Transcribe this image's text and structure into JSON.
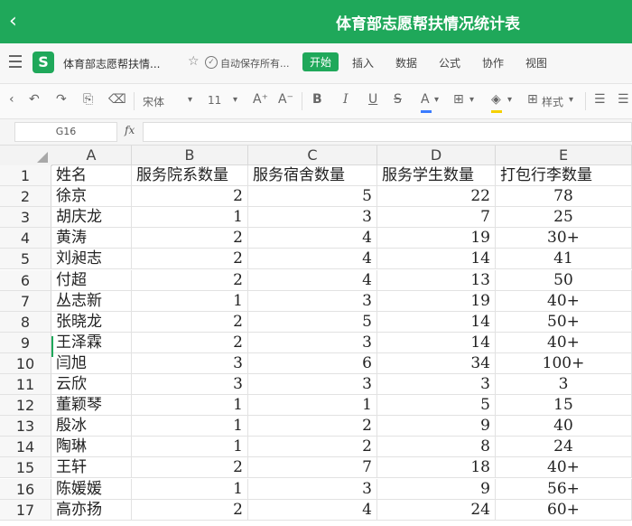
{
  "header": {
    "back_icon": "chevron-left-icon",
    "title": "体育部志愿帮扶情况统计表"
  },
  "menubar": {
    "file_name": "体育部志愿帮扶情...",
    "autosave": "自动保存所有...",
    "tabs": [
      "开始",
      "插入",
      "数据",
      "公式",
      "协作",
      "视图"
    ],
    "active_tab": "开始",
    "accent": "#1fa85a"
  },
  "toolbar": {
    "font_name": "宋体",
    "font_size": "11",
    "style_label": "样式"
  },
  "formula": {
    "name_box": "G16",
    "fx": "fx",
    "value": ""
  },
  "sheet": {
    "columns": [
      "A",
      "B",
      "C",
      "D",
      "E"
    ],
    "rows": [
      "1",
      "2",
      "3",
      "4",
      "5",
      "6",
      "7",
      "8",
      "9",
      "10",
      "11",
      "12",
      "13",
      "14",
      "15",
      "16",
      "17"
    ],
    "header_row": [
      "姓名",
      "服务院系数量",
      "服务宿舍数量",
      "服务学生数量",
      "打包行李数量"
    ],
    "data": [
      [
        "徐京",
        "2",
        "5",
        "22",
        "78"
      ],
      [
        "胡庆龙",
        "1",
        "3",
        "7",
        "25"
      ],
      [
        "黄涛",
        "2",
        "4",
        "19",
        "30+"
      ],
      [
        "刘昶志",
        "2",
        "4",
        "14",
        "41"
      ],
      [
        "付超",
        "2",
        "4",
        "13",
        "50"
      ],
      [
        "丛志新",
        "1",
        "3",
        "19",
        "40+"
      ],
      [
        "张晓龙",
        "2",
        "5",
        "14",
        "50+"
      ],
      [
        "王泽霖",
        "2",
        "3",
        "14",
        "40+"
      ],
      [
        "闫旭",
        "3",
        "6",
        "34",
        "100+"
      ],
      [
        "云欣",
        "3",
        "3",
        "3",
        "3"
      ],
      [
        "董颖琴",
        "1",
        "1",
        "5",
        "15"
      ],
      [
        "殷冰",
        "1",
        "2",
        "9",
        "40"
      ],
      [
        "陶琳",
        "1",
        "2",
        "8",
        "24"
      ],
      [
        "王轩",
        "2",
        "7",
        "18",
        "40+"
      ],
      [
        "陈媛媛",
        "1",
        "3",
        "9",
        "56+"
      ],
      [
        "高亦扬",
        "2",
        "4",
        "24",
        "60+"
      ]
    ]
  }
}
